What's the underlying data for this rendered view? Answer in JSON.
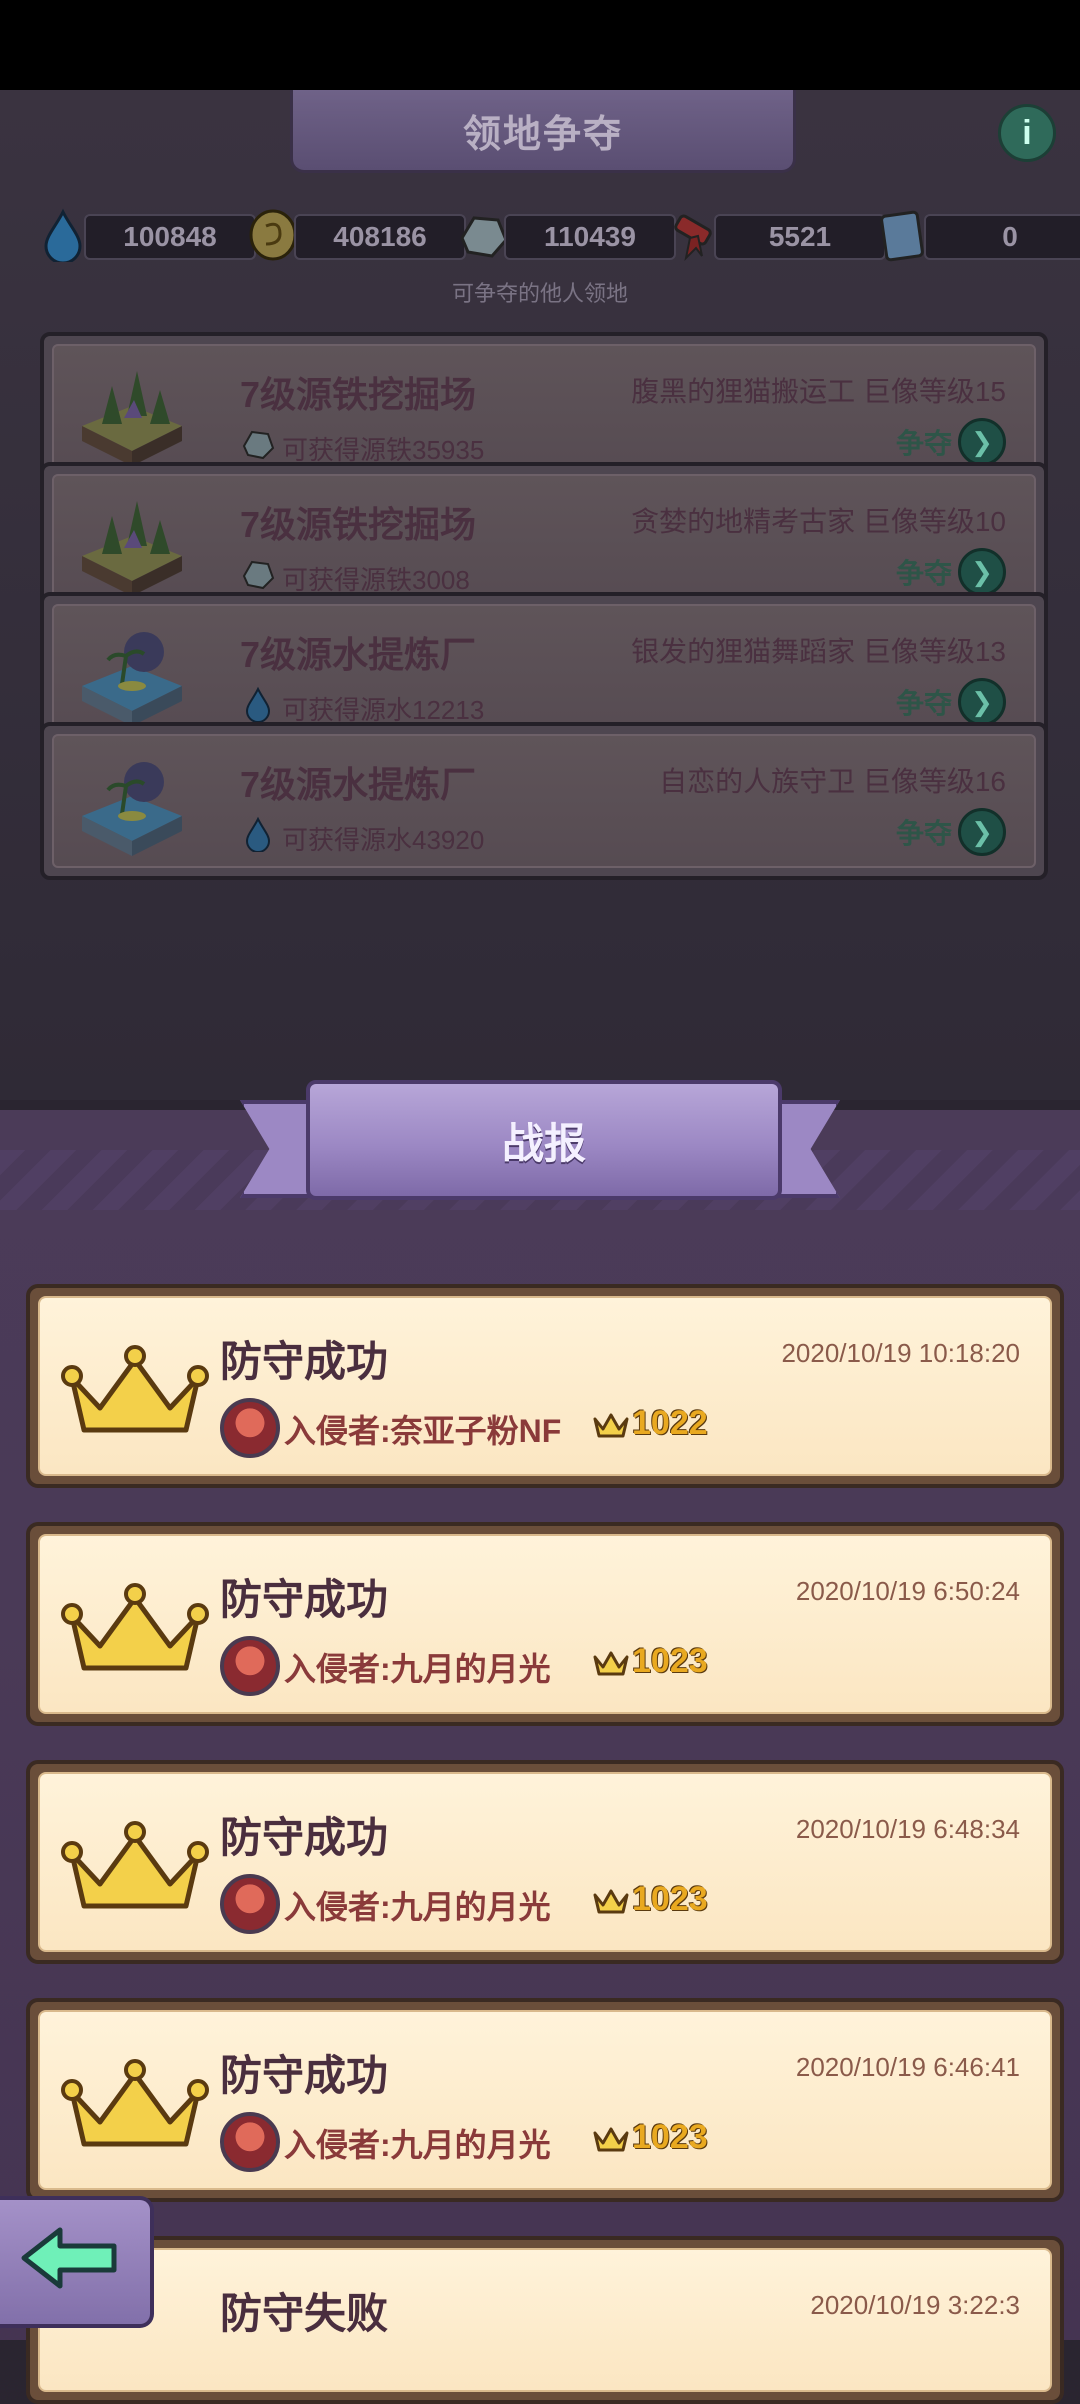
{
  "header": {
    "title": "领地争夺",
    "info_label": "i"
  },
  "resources": [
    {
      "icon": "water-drop-icon",
      "value": "100848"
    },
    {
      "icon": "coin-icon",
      "value": "408186"
    },
    {
      "icon": "ore-icon",
      "value": "110439"
    },
    {
      "icon": "scroll-icon",
      "value": "5521"
    },
    {
      "icon": "card-icon",
      "value": "0"
    }
  ],
  "subtitle": "可争夺的他人领地",
  "territories": [
    {
      "name": "7级源铁挖掘场",
      "gain": "可获得源铁35935",
      "owner": "腹黑的狸猫搬运工 巨像等级15",
      "button": "争夺",
      "kind": "iron"
    },
    {
      "name": "7级源铁挖掘场",
      "gain": "可获得源铁3008",
      "owner": "贪婪的地精考古家 巨像等级10",
      "button": "争夺",
      "kind": "iron"
    },
    {
      "name": "7级源水提炼厂",
      "gain": "可获得源水12213",
      "owner": "银发的狸猫舞蹈家 巨像等级13",
      "button": "争夺",
      "kind": "water"
    },
    {
      "name": "7级源水提炼厂",
      "gain": "可获得源水43920",
      "owner": "自恋的人族守卫 巨像等级16",
      "button": "争夺",
      "kind": "water"
    }
  ],
  "report_panel": {
    "title": "战报"
  },
  "reports": [
    {
      "result": "防守成功",
      "time": "2020/10/19 10:18:20",
      "invader": "入侵者:奈亚子粉NF",
      "trophies": "1022"
    },
    {
      "result": "防守成功",
      "time": "2020/10/19 6:50:24",
      "invader": "入侵者:九月的月光",
      "trophies": "1023"
    },
    {
      "result": "防守成功",
      "time": "2020/10/19 6:48:34",
      "invader": "入侵者:九月的月光",
      "trophies": "1023"
    },
    {
      "result": "防守成功",
      "time": "2020/10/19 6:46:41",
      "invader": "入侵者:九月的月光",
      "trophies": "1023"
    },
    {
      "result": "防守失败",
      "time": "2020/10/19 3:22:3",
      "invader": "",
      "trophies": ""
    }
  ],
  "colors": {
    "accent": "#e9a920",
    "panel": "#4b3b58",
    "card": "#fbe6c2"
  }
}
